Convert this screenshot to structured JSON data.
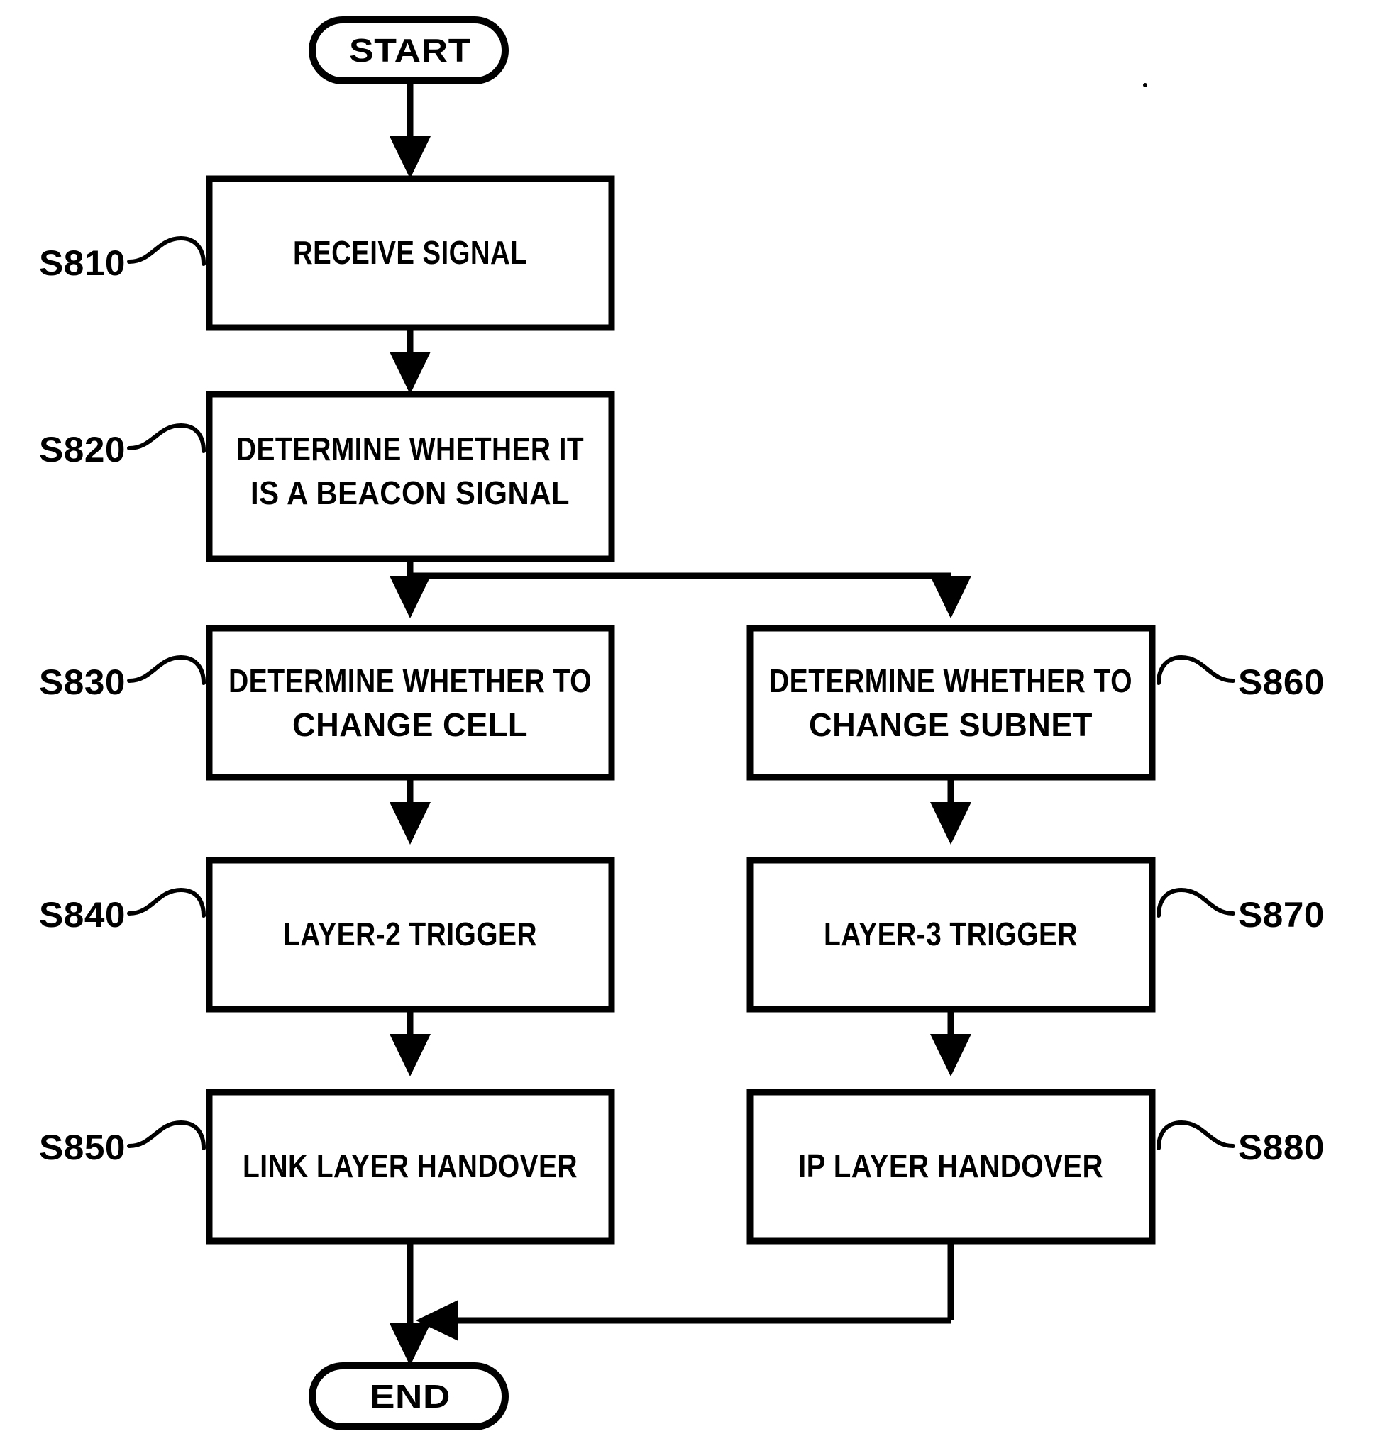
{
  "figure": {
    "type": "flowchart",
    "orientation": "top-down, two-branch",
    "background_color": "#ffffff",
    "line_color": "#000000"
  },
  "terminators": {
    "start": "START",
    "end": "END"
  },
  "steps": [
    {
      "id": "S810",
      "label": "S810",
      "text_lines": [
        "RECEIVE SIGNAL"
      ],
      "column": "left"
    },
    {
      "id": "S820",
      "label": "S820",
      "text_lines": [
        "DETERMINE WHETHER IT",
        "IS A BEACON SIGNAL"
      ],
      "column": "left"
    },
    {
      "id": "S830",
      "label": "S830",
      "text_lines": [
        "DETERMINE WHETHER TO",
        "CHANGE CELL"
      ],
      "column": "left"
    },
    {
      "id": "S840",
      "label": "S840",
      "text_lines": [
        "LAYER-2 TRIGGER"
      ],
      "column": "left"
    },
    {
      "id": "S850",
      "label": "S850",
      "text_lines": [
        "LINK LAYER HANDOVER"
      ],
      "column": "left"
    },
    {
      "id": "S860",
      "label": "S860",
      "text_lines": [
        "DETERMINE WHETHER TO",
        "CHANGE SUBNET"
      ],
      "column": "right"
    },
    {
      "id": "S870",
      "label": "S870",
      "text_lines": [
        "LAYER-3 TRIGGER"
      ],
      "column": "right"
    },
    {
      "id": "S880",
      "label": "S880",
      "text_lines": [
        "IP LAYER HANDOVER"
      ],
      "column": "right"
    }
  ],
  "box_text": {
    "s810_l1": "RECEIVE SIGNAL",
    "s820_l1": "DETERMINE WHETHER IT",
    "s820_l2": "IS A BEACON SIGNAL",
    "s830_l1": "DETERMINE WHETHER TO",
    "s830_l2": "CHANGE CELL",
    "s840_l1": "LAYER-2 TRIGGER",
    "s850_l1": "LINK LAYER HANDOVER",
    "s860_l1": "DETERMINE WHETHER TO",
    "s860_l2": "CHANGE SUBNET",
    "s870_l1": "LAYER-3 TRIGGER",
    "s880_l1": "IP LAYER HANDOVER"
  },
  "step_labels": {
    "s810": "S810",
    "s820": "S820",
    "s830": "S830",
    "s840": "S840",
    "s850": "S850",
    "s860": "S860",
    "s870": "S870",
    "s880": "S880"
  },
  "flow": {
    "edges": [
      {
        "from": "START",
        "to": "S810"
      },
      {
        "from": "S810",
        "to": "S820"
      },
      {
        "from": "S820",
        "to": "S830"
      },
      {
        "from": "S820",
        "to": "S860"
      },
      {
        "from": "S830",
        "to": "S840"
      },
      {
        "from": "S840",
        "to": "S850"
      },
      {
        "from": "S860",
        "to": "S870"
      },
      {
        "from": "S870",
        "to": "S880"
      },
      {
        "from": "S850",
        "to": "END"
      },
      {
        "from": "S880",
        "to": "END"
      }
    ]
  }
}
